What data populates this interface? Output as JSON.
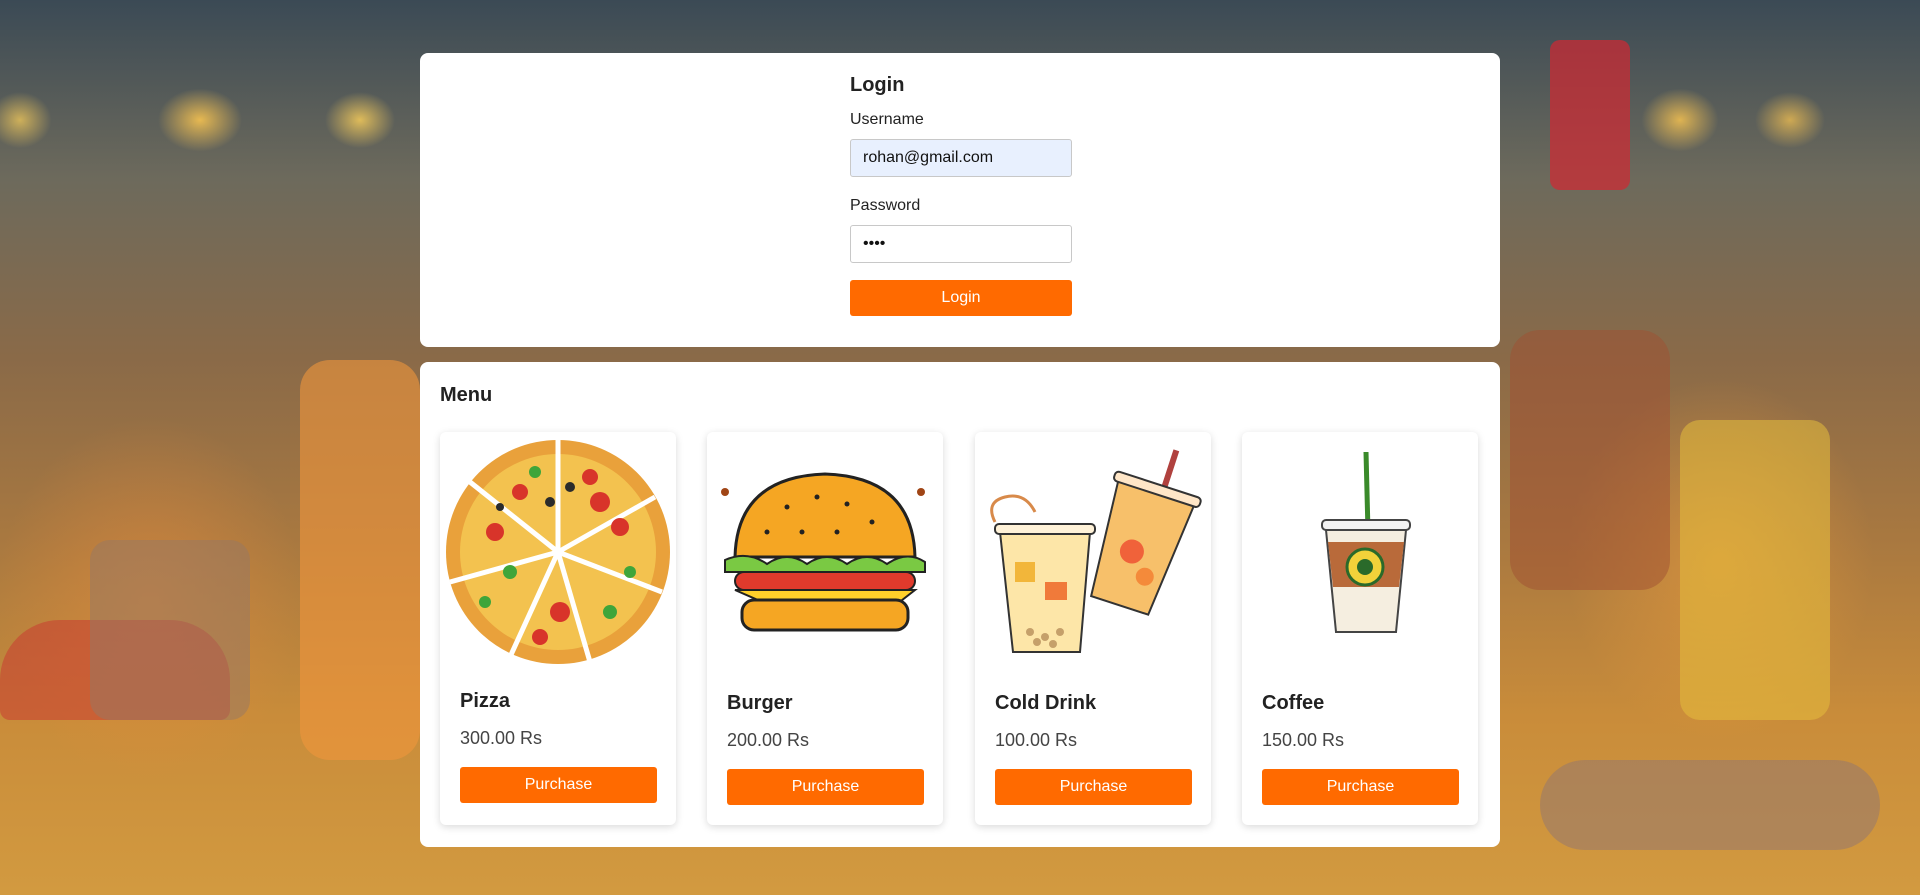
{
  "login": {
    "title": "Login",
    "username_label": "Username",
    "username_value": "rohan@gmail.com",
    "password_label": "Password",
    "password_value": "1234",
    "button_label": "Login"
  },
  "menu": {
    "title": "Menu",
    "items": [
      {
        "name": "Pizza",
        "price": "300.00 Rs",
        "button_label": "Purchase",
        "icon": "pizza-image"
      },
      {
        "name": "Burger",
        "price": "200.00 Rs",
        "button_label": "Purchase",
        "icon": "burger-image"
      },
      {
        "name": "Cold Drink",
        "price": "100.00 Rs",
        "button_label": "Purchase",
        "icon": "cold-drink-image"
      },
      {
        "name": "Coffee",
        "price": "150.00 Rs",
        "button_label": "Purchase",
        "icon": "coffee-image"
      }
    ]
  },
  "colors": {
    "accent": "#ff6a00",
    "panel": "#ffffff",
    "input_autofill": "#e8f0fe"
  }
}
